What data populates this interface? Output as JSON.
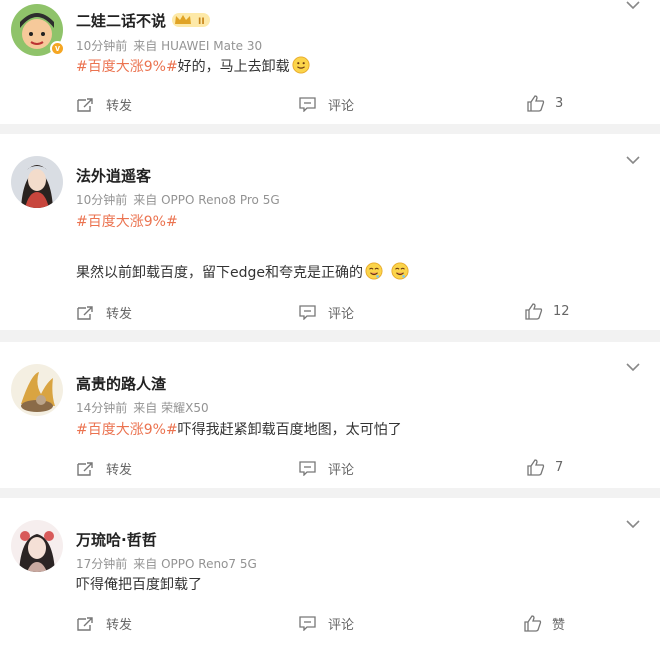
{
  "posts": [
    {
      "name": "二娃二话不说",
      "time": "10分钟前",
      "source": "来自 HUAWEI Mate 30",
      "topic": "#百度大涨9%#",
      "text": "好的，马上去卸载",
      "repost_label": "转发",
      "comment_label": "评论",
      "like_count": "3"
    },
    {
      "name": "法外逍遥客",
      "time": "10分钟前",
      "source": "来自 OPPO Reno8 Pro 5G",
      "topic": "#百度大涨9%#",
      "text": "果然以前卸载百度，留下edge和夸克是正确的",
      "repost_label": "转发",
      "comment_label": "评论",
      "like_count": "12"
    },
    {
      "name": "高贵的路人渣",
      "time": "14分钟前",
      "source": "来自 荣耀X50",
      "topic": "#百度大涨9%#",
      "text": "吓得我赶紧卸载百度地图，太可怕了",
      "repost_label": "转发",
      "comment_label": "评论",
      "like_count": "7"
    },
    {
      "name": "万琉哈·哲哲",
      "time": "17分钟前",
      "source": "来自 OPPO Reno7 5G",
      "text": "吓得俺把百度卸载了",
      "repost_label": "转发",
      "comment_label": "评论",
      "like_label": "赞"
    }
  ],
  "colors": {
    "topic": "#eb7350",
    "meta": "#939393",
    "background": "#f2f2f2",
    "vip_badge": "#f5a623"
  },
  "icons": [
    "chevron-down-icon",
    "repost-icon",
    "comment-icon",
    "thumbs-up-icon",
    "smile-emoji-icon",
    "drool-emoji-icon",
    "vip-crown-icon",
    "verified-badge-icon"
  ]
}
